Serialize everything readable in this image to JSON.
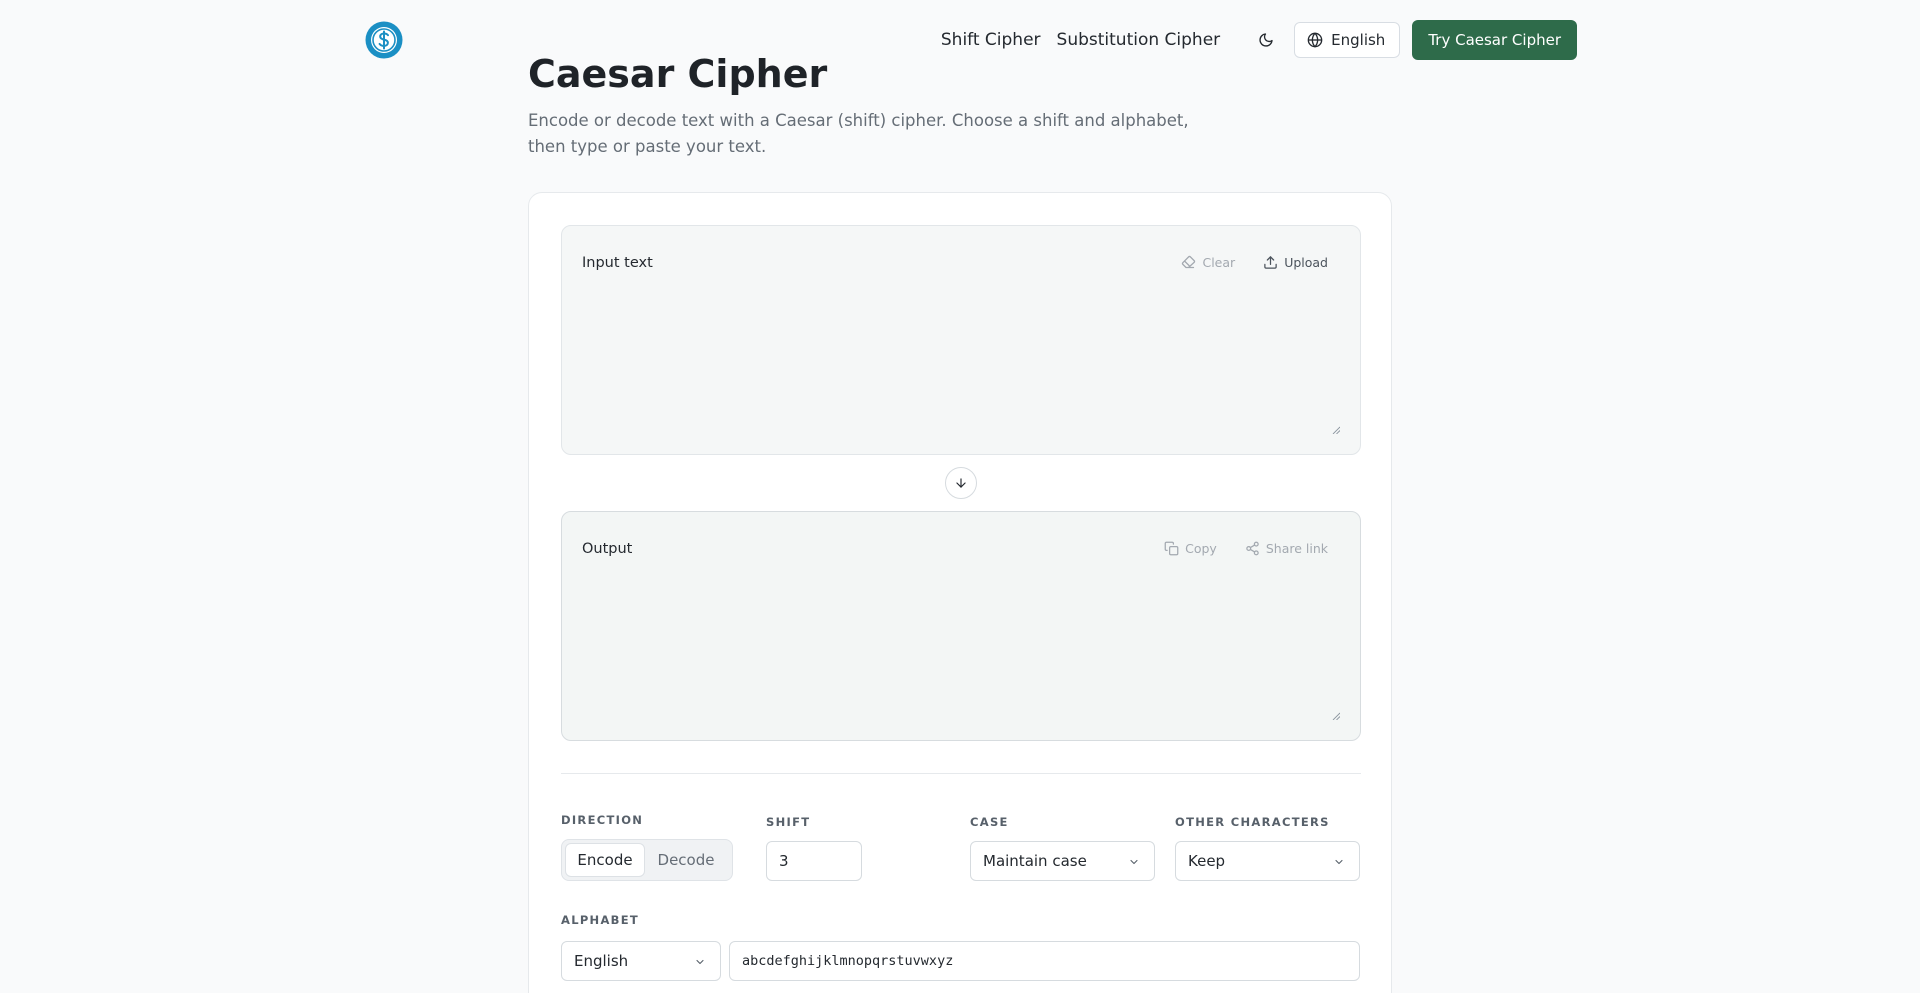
{
  "header": {
    "logo_icon": "dollar-circle-icon",
    "nav_links": [
      "Shift Cipher",
      "Substitution Cipher"
    ],
    "theme_icon": "moon-icon",
    "language": "English",
    "cta": "Try Caesar Cipher",
    "cta_color": "#2e6b4a",
    "accent_color": "#1b8fc4"
  },
  "page": {
    "title": "Caesar Cipher",
    "subtitle_line1": "Encode or decode text with a Caesar (shift) cipher. Choose a shift and alphabet,",
    "subtitle_line2": "then type or paste your text."
  },
  "input_panel": {
    "label": "Input text",
    "clear_label": "Clear",
    "upload_label": "Upload",
    "value": ""
  },
  "output_panel": {
    "label": "Output",
    "copy_label": "Copy",
    "share_label": "Share link",
    "value": ""
  },
  "controls": {
    "direction_label": "DIRECTION",
    "direction_options": [
      "Encode",
      "Decode"
    ],
    "direction_selected": "Encode",
    "shift_label": "SHIFT",
    "shift_value": "3",
    "case_label": "CASE",
    "case_value": "Maintain case",
    "other_label": "OTHER CHARACTERS",
    "other_value": "Keep",
    "alphabet_label": "ALPHABET",
    "alphabet_value": "English",
    "alphabet_string": "abcdefghijklmnopqrstuvwxyz"
  }
}
